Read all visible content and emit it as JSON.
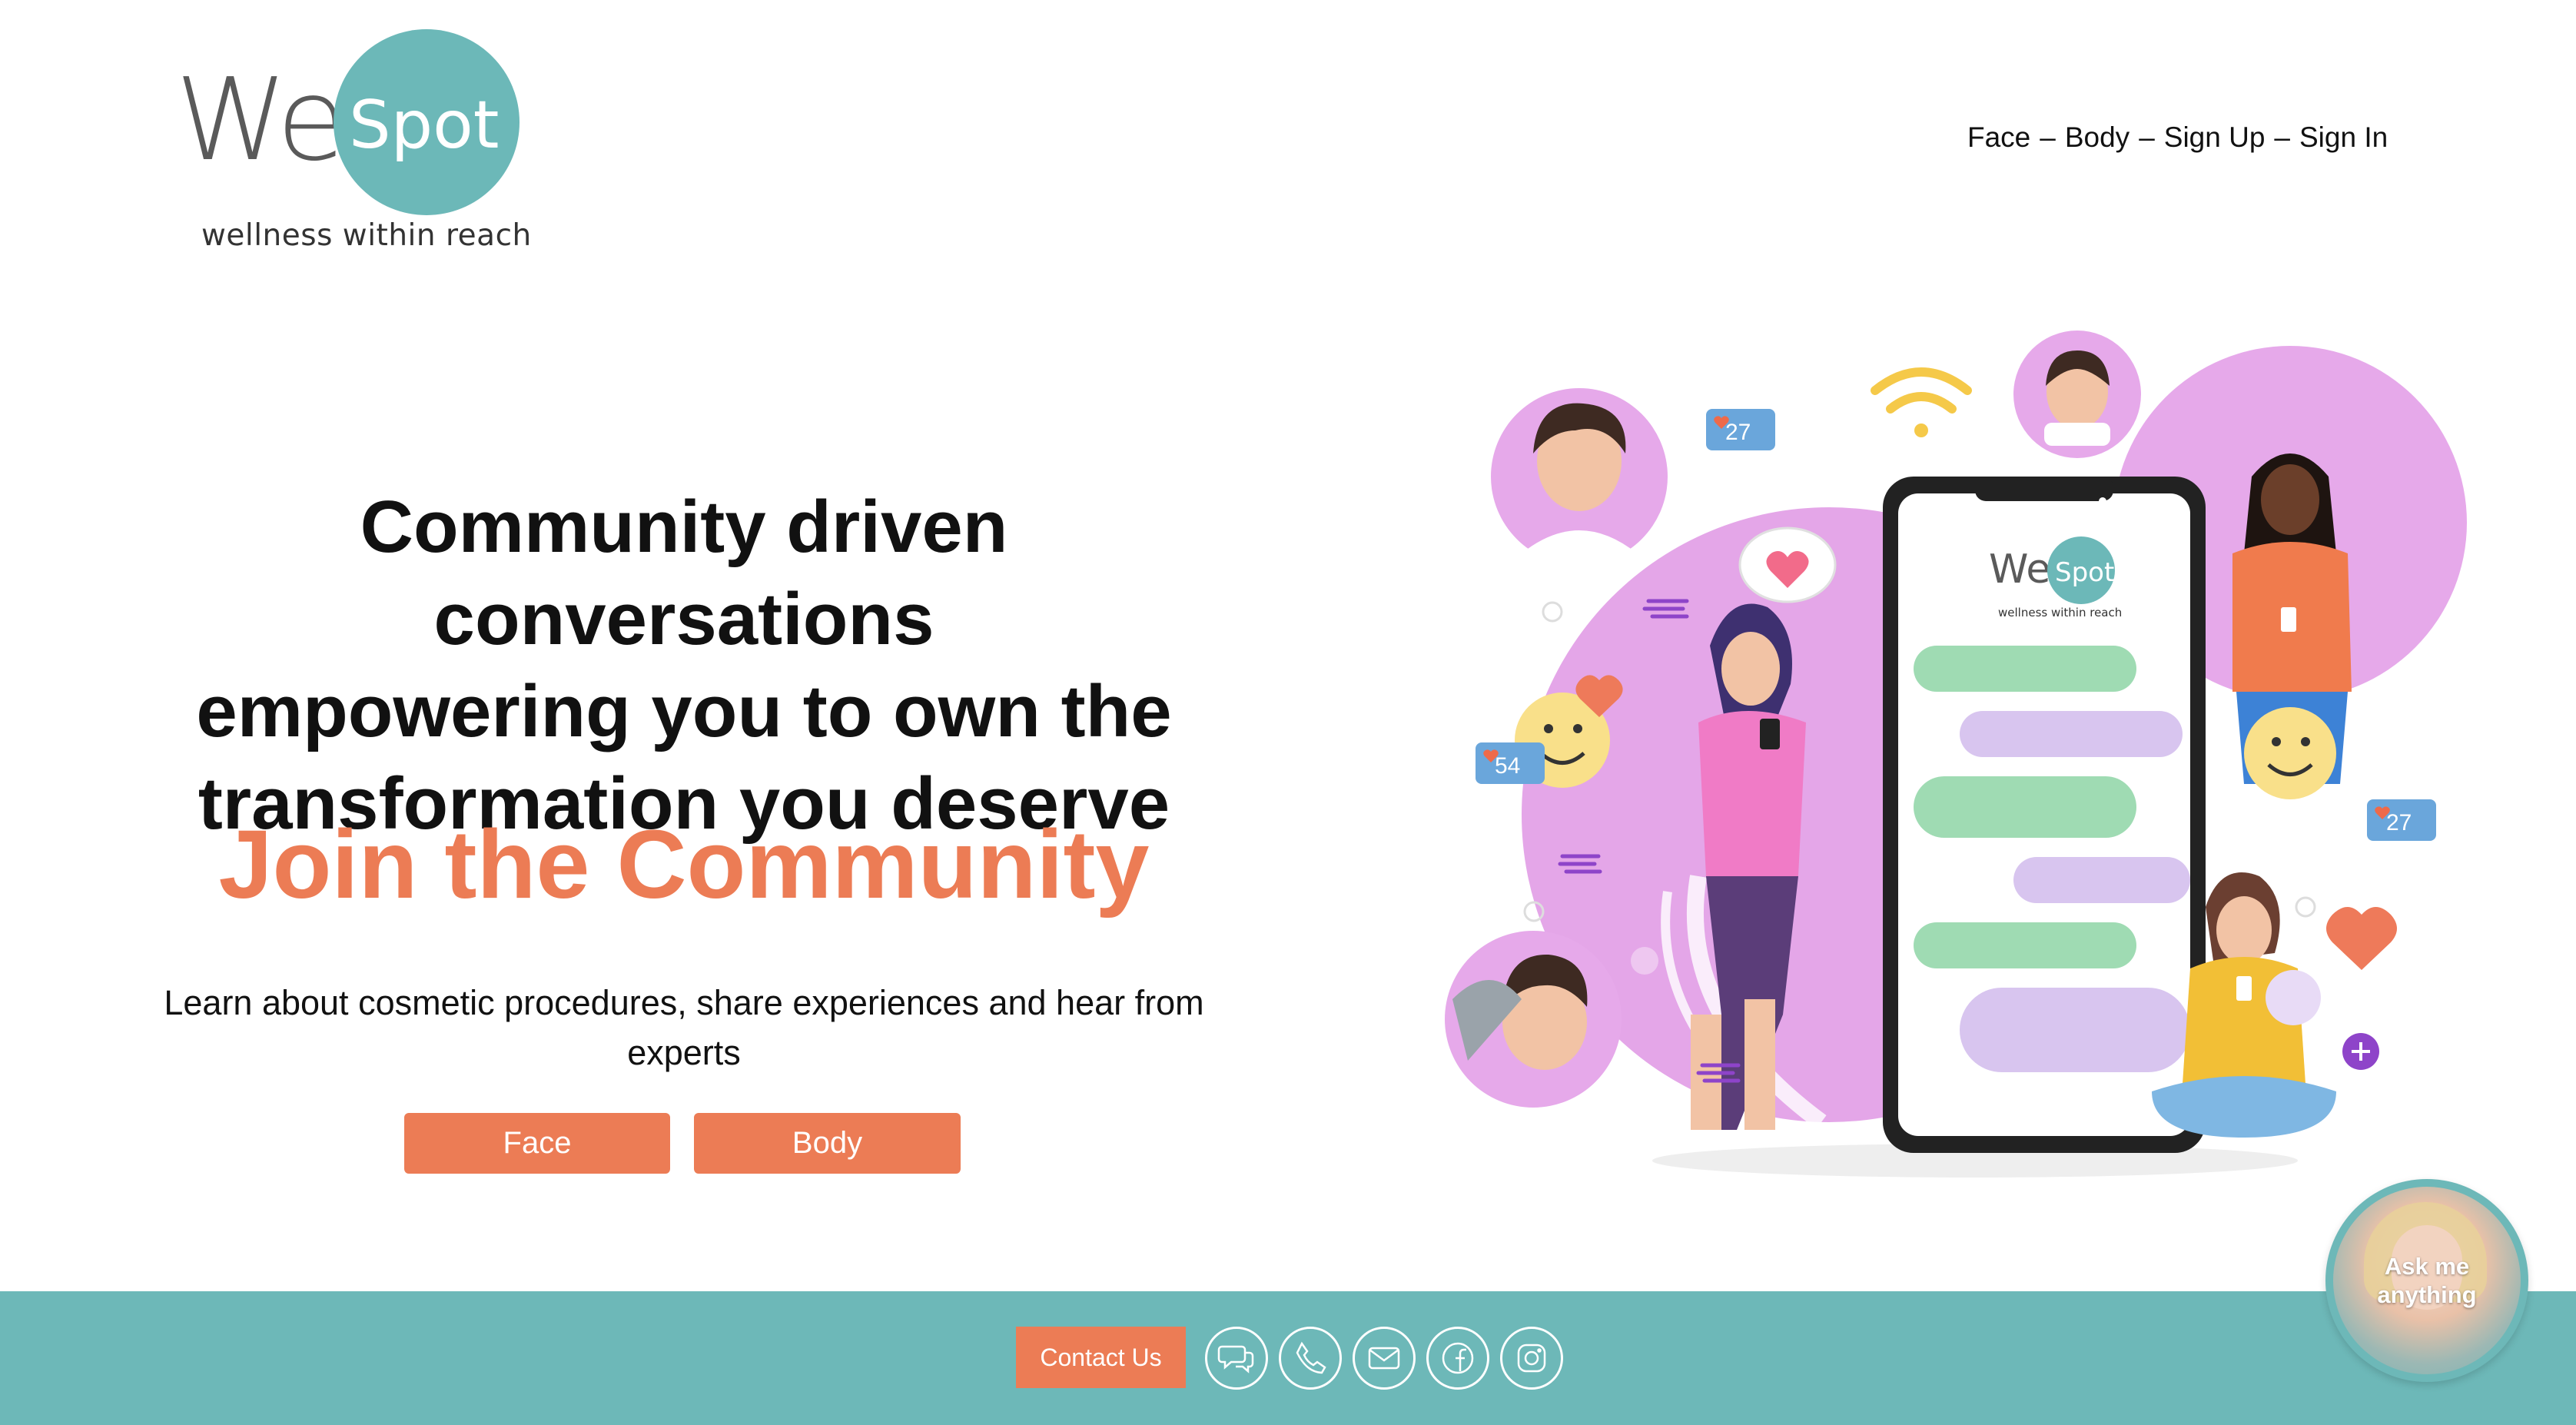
{
  "header": {
    "logo": {
      "wel": "Wel",
      "spot": "Spot",
      "tagline": "wellness within reach"
    },
    "nav": {
      "items": [
        {
          "label": "Face"
        },
        {
          "label": "Body"
        },
        {
          "label": "Sign Up"
        },
        {
          "label": "Sign In"
        }
      ],
      "separator": "–"
    }
  },
  "hero": {
    "headline_lines": [
      "Community driven conversations",
      "empowering you to own the",
      "transformation you deserve"
    ],
    "join_title": "Join the Community",
    "subtitle": "Learn about cosmetic procedures, share experiences and hear from experts",
    "buttons": {
      "face": "Face",
      "body": "Body"
    }
  },
  "illustration": {
    "phone_logo_wel": "Wel",
    "phone_logo_spot": "Spot",
    "phone_tagline": "wellness within reach",
    "badges": [
      "27",
      "54",
      "27"
    ]
  },
  "footer": {
    "contact_label": "Contact Us",
    "social_icons": [
      "chat-icon",
      "phone-icon",
      "mail-icon",
      "facebook-icon",
      "instagram-icon"
    ]
  },
  "chat_widget": {
    "label_line1": "Ask me",
    "label_line2": "anything"
  },
  "colors": {
    "accent": "#ec7c55",
    "teal": "#6db8b8",
    "lilac": "#e4a6e8",
    "text": "#111111"
  }
}
